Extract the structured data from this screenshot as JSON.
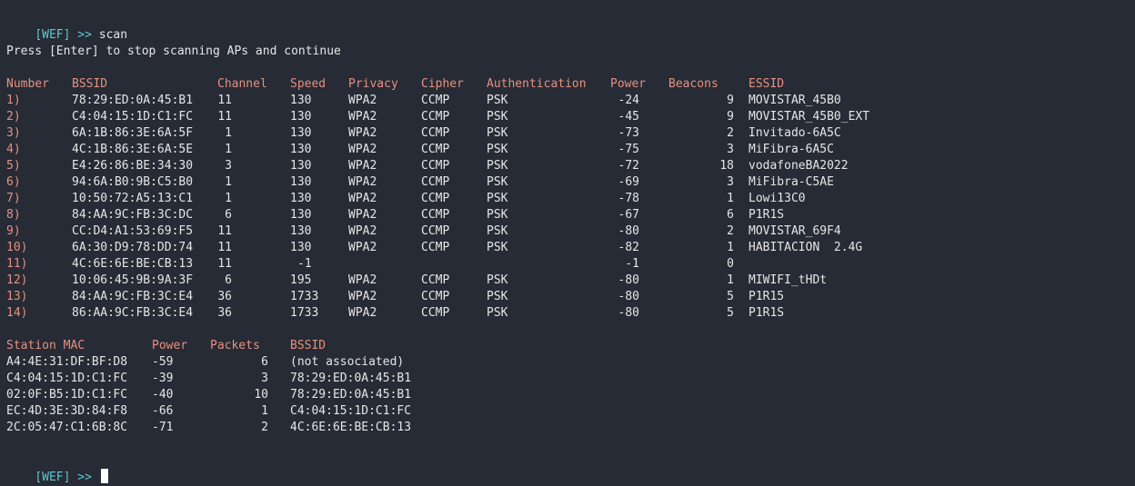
{
  "prompt": {
    "tag": "[WEF]",
    "arrows": ">>",
    "command": "scan"
  },
  "message": "Press [Enter] to stop scanning APs and continue",
  "ap_headers": [
    "Number",
    "BSSID",
    "Channel",
    "Speed",
    "Privacy",
    "Cipher",
    "Authentication",
    "Power",
    "Beacons",
    "ESSID"
  ],
  "access_points": [
    {
      "num": "1)",
      "bssid": "78:29:ED:0A:45:B1",
      "channel": "11",
      "speed": "130",
      "privacy": "WPA2",
      "cipher": "CCMP",
      "auth": "PSK",
      "power": "-24",
      "beacons": "9",
      "essid": "MOVISTAR_45B0"
    },
    {
      "num": "2)",
      "bssid": "C4:04:15:1D:C1:FC",
      "channel": "11",
      "speed": "130",
      "privacy": "WPA2",
      "cipher": "CCMP",
      "auth": "PSK",
      "power": "-45",
      "beacons": "9",
      "essid": "MOVISTAR_45B0_EXT"
    },
    {
      "num": "3)",
      "bssid": "6A:1B:86:3E:6A:5F",
      "channel": "1",
      "speed": "130",
      "privacy": "WPA2",
      "cipher": "CCMP",
      "auth": "PSK",
      "power": "-73",
      "beacons": "2",
      "essid": "Invitado-6A5C"
    },
    {
      "num": "4)",
      "bssid": "4C:1B:86:3E:6A:5E",
      "channel": "1",
      "speed": "130",
      "privacy": "WPA2",
      "cipher": "CCMP",
      "auth": "PSK",
      "power": "-75",
      "beacons": "3",
      "essid": "MiFibra-6A5C"
    },
    {
      "num": "5)",
      "bssid": "E4:26:86:BE:34:30",
      "channel": "3",
      "speed": "130",
      "privacy": "WPA2",
      "cipher": "CCMP",
      "auth": "PSK",
      "power": "-72",
      "beacons": "18",
      "essid": "vodafoneBA2022"
    },
    {
      "num": "6)",
      "bssid": "94:6A:B0:9B:C5:B0",
      "channel": "1",
      "speed": "130",
      "privacy": "WPA2",
      "cipher": "CCMP",
      "auth": "PSK",
      "power": "-69",
      "beacons": "3",
      "essid": "MiFibra-C5AE"
    },
    {
      "num": "7)",
      "bssid": "10:50:72:A5:13:C1",
      "channel": "1",
      "speed": "130",
      "privacy": "WPA2",
      "cipher": "CCMP",
      "auth": "PSK",
      "power": "-78",
      "beacons": "1",
      "essid": "Lowi13C0"
    },
    {
      "num": "8)",
      "bssid": "84:AA:9C:FB:3C:DC",
      "channel": "6",
      "speed": "130",
      "privacy": "WPA2",
      "cipher": "CCMP",
      "auth": "PSK",
      "power": "-67",
      "beacons": "6",
      "essid": "P1R1S"
    },
    {
      "num": "9)",
      "bssid": "CC:D4:A1:53:69:F5",
      "channel": "11",
      "speed": "130",
      "privacy": "WPA2",
      "cipher": "CCMP",
      "auth": "PSK",
      "power": "-80",
      "beacons": "2",
      "essid": "MOVISTAR_69F4"
    },
    {
      "num": "10)",
      "bssid": "6A:30:D9:78:DD:74",
      "channel": "11",
      "speed": "130",
      "privacy": "WPA2",
      "cipher": "CCMP",
      "auth": "PSK",
      "power": "-82",
      "beacons": "1",
      "essid": "HABITACION  2.4G"
    },
    {
      "num": "11)",
      "bssid": "4C:6E:6E:BE:CB:13",
      "channel": "11",
      "speed": "-1",
      "privacy": "",
      "cipher": "",
      "auth": "",
      "power": "-1",
      "beacons": "0",
      "essid": ""
    },
    {
      "num": "12)",
      "bssid": "10:06:45:9B:9A:3F",
      "channel": "6",
      "speed": "195",
      "privacy": "WPA2",
      "cipher": "CCMP",
      "auth": "PSK",
      "power": "-80",
      "beacons": "1",
      "essid": "MIWIFI_tHDt"
    },
    {
      "num": "13)",
      "bssid": "84:AA:9C:FB:3C:E4",
      "channel": "36",
      "speed": "1733",
      "privacy": "WPA2",
      "cipher": "CCMP",
      "auth": "PSK",
      "power": "-80",
      "beacons": "5",
      "essid": "P1R15"
    },
    {
      "num": "14)",
      "bssid": "86:AA:9C:FB:3C:E4",
      "channel": "36",
      "speed": "1733",
      "privacy": "WPA2",
      "cipher": "CCMP",
      "auth": "PSK",
      "power": "-80",
      "beacons": "5",
      "essid": "P1R1S"
    }
  ],
  "station_headers": [
    "Station MAC",
    "Power",
    "Packets",
    "BSSID"
  ],
  "stations": [
    {
      "mac": "A4:4E:31:DF:BF:D8",
      "power": "-59",
      "packets": "6",
      "bssid": "(not associated)"
    },
    {
      "mac": "C4:04:15:1D:C1:FC",
      "power": "-39",
      "packets": "3",
      "bssid": "78:29:ED:0A:45:B1"
    },
    {
      "mac": "02:0F:B5:1D:C1:FC",
      "power": "-40",
      "packets": "10",
      "bssid": "78:29:ED:0A:45:B1"
    },
    {
      "mac": "EC:4D:3E:3D:84:F8",
      "power": "-66",
      "packets": "1",
      "bssid": "C4:04:15:1D:C1:FC"
    },
    {
      "mac": "2C:05:47:C1:6B:8C",
      "power": "-71",
      "packets": "2",
      "bssid": "4C:6E:6E:BE:CB:13"
    }
  ],
  "colors": {
    "background": "#262b35",
    "prompt": "#5fc9d4",
    "header": "#e8907f",
    "text": "#e6e6e6"
  }
}
